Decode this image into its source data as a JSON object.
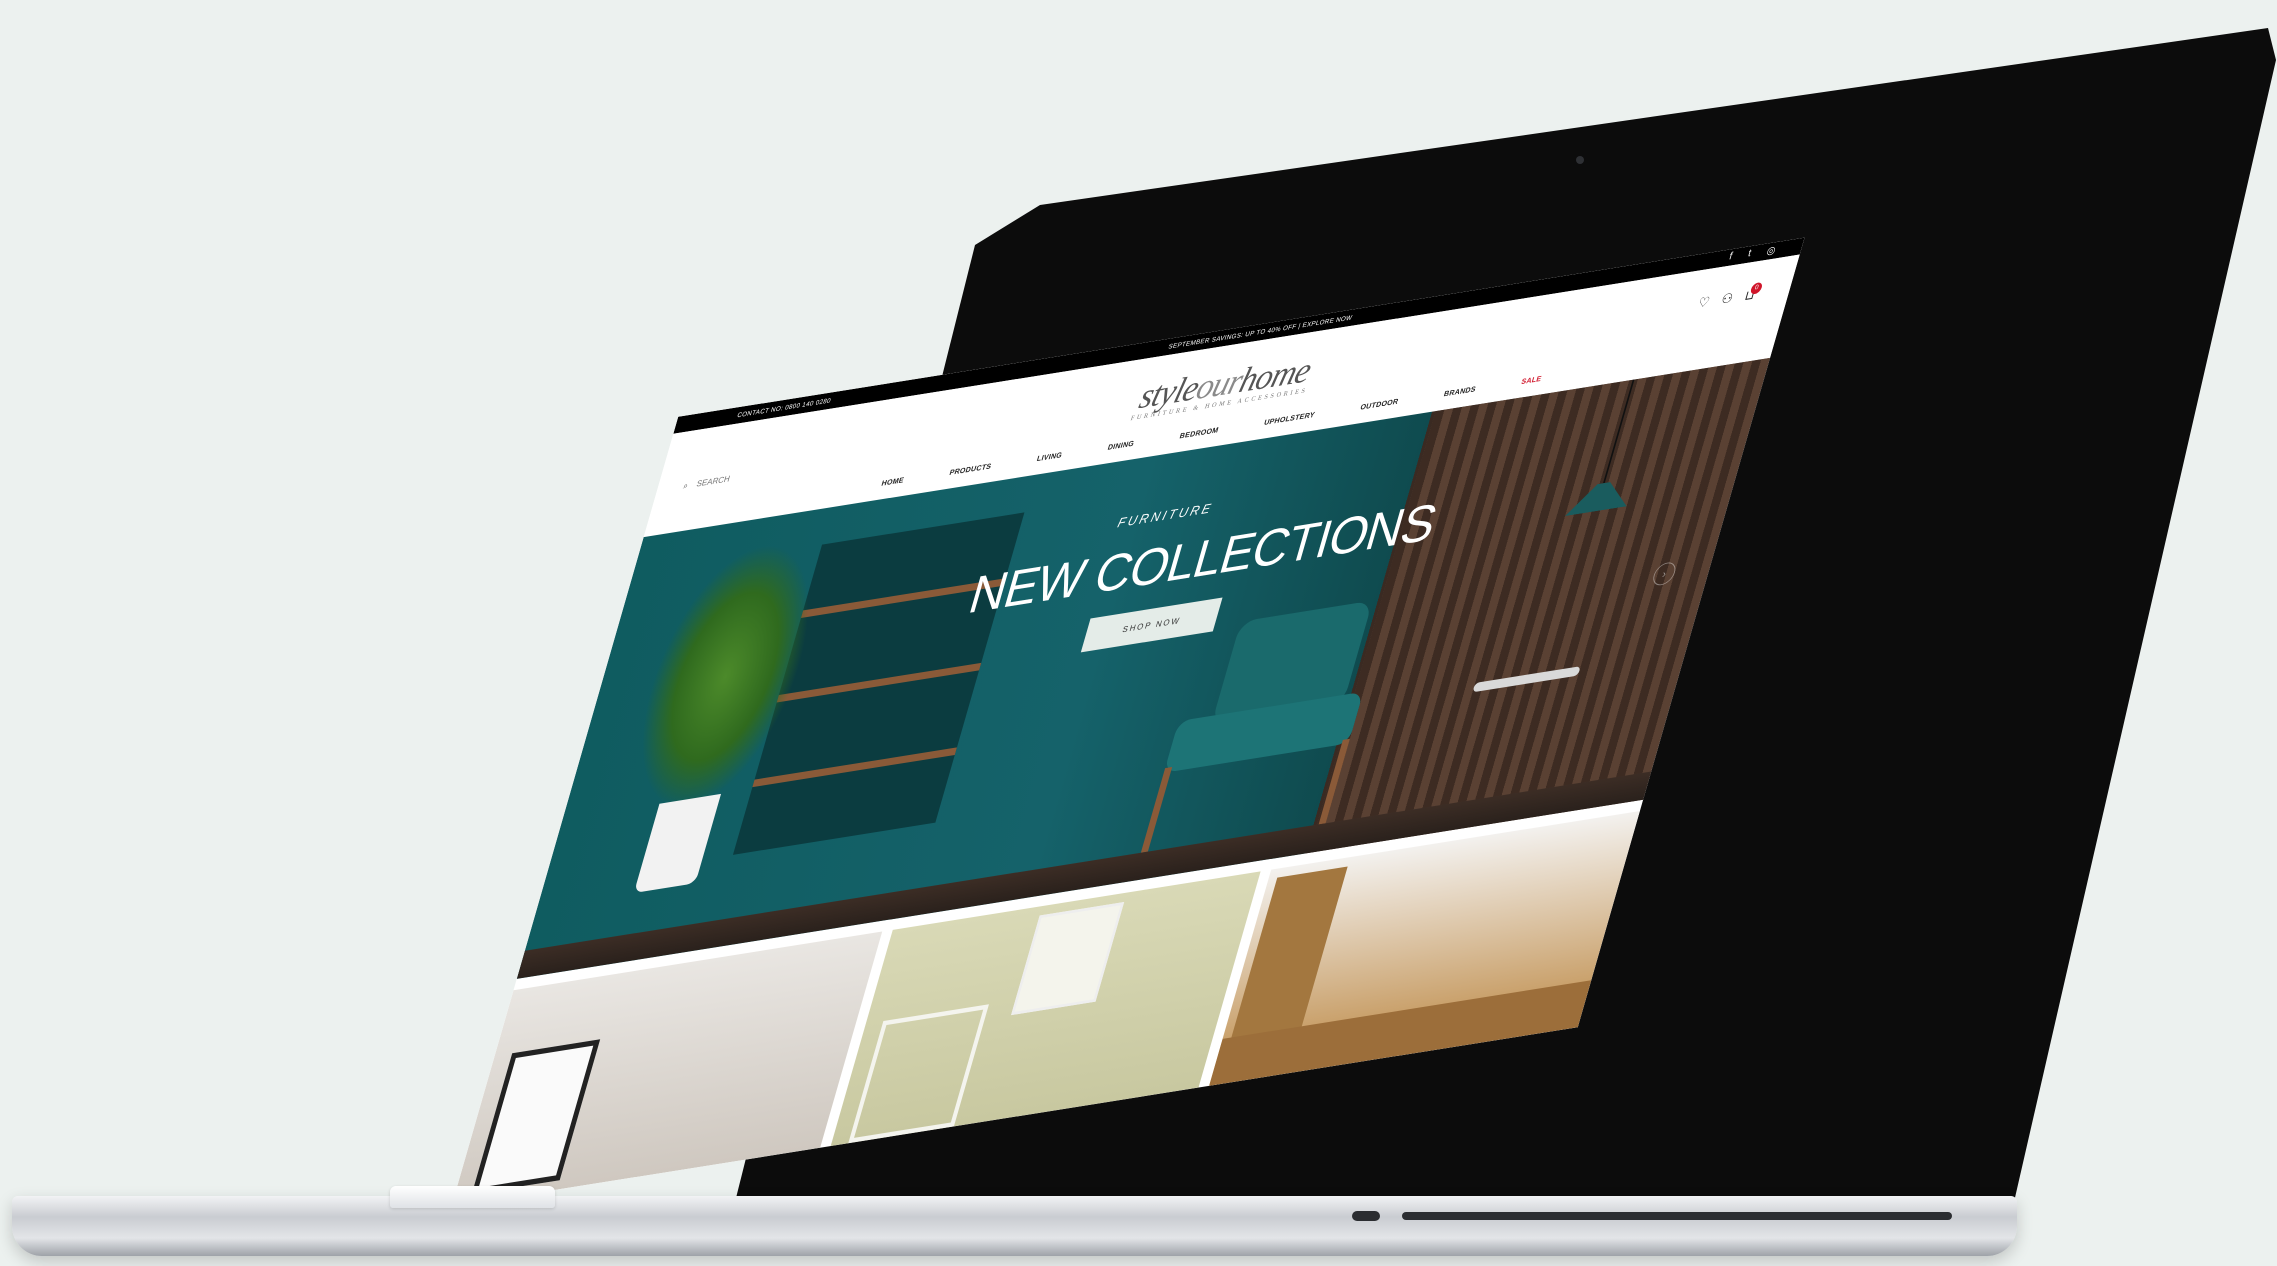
{
  "topbar": {
    "contact": "CONTACT NO: 0800 140 0280",
    "promo": "SEPTEMBER SAVINGS: UP TO 40% OFF | EXPLORE NOW",
    "social": [
      {
        "icon": "facebook-icon",
        "glyph": "f"
      },
      {
        "icon": "twitter-icon",
        "glyph": "t"
      },
      {
        "icon": "instagram-icon",
        "glyph": "◎"
      }
    ]
  },
  "header": {
    "logo_main_a": "style",
    "logo_main_b": "our",
    "logo_main_c": "home",
    "logo_tagline": "FURNITURE & HOME ACCESSORIES",
    "search_placeholder": "SEARCH",
    "cart_count": "0"
  },
  "nav": {
    "items": [
      "HOME",
      "PRODUCTS",
      "LIVING",
      "DINING",
      "BEDROOM",
      "UPHOLSTERY",
      "OUTDOOR",
      "BRANDS"
    ],
    "sale": "SALE"
  },
  "hero": {
    "kicker": "FURNITURE",
    "title": "NEW COLLECTIONS",
    "button": "SHOP NOW"
  },
  "colors": {
    "accent": "#d0152a",
    "hero_teal": "#0f5c60"
  }
}
